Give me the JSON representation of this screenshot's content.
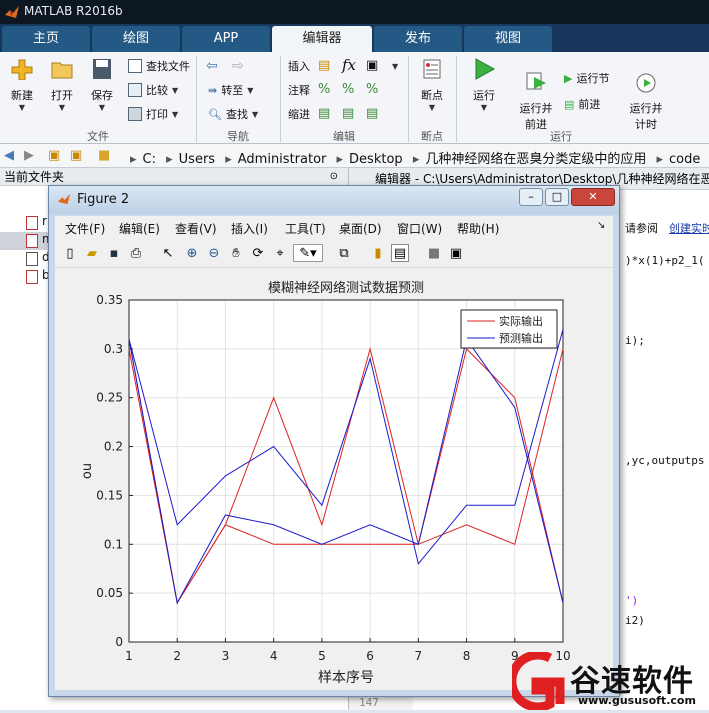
{
  "app": {
    "title": "MATLAB R2016b"
  },
  "tabs": [
    {
      "label": "主页",
      "active": false
    },
    {
      "label": "绘图",
      "active": false
    },
    {
      "label": "APP",
      "active": false
    },
    {
      "label": "编辑器",
      "active": true
    },
    {
      "label": "发布",
      "active": false
    },
    {
      "label": "视图",
      "active": false
    }
  ],
  "ribbon": {
    "new": "新建",
    "open": "打开",
    "save": "保存",
    "find_files": "查找文件",
    "compare": "比较",
    "print": "打印",
    "goto": "转至",
    "find": "查找",
    "insert": "插入",
    "comment": "注释",
    "indent": "缩进",
    "breakpoints": "断点",
    "run": "运行",
    "run_advance": "运行并\n前进",
    "run_section": "运行节",
    "advance": "前进",
    "run_time": "运行并\n计时",
    "sections": {
      "file": "文件",
      "navigate": "导航",
      "edit": "编辑",
      "breakpoints": "断点",
      "run": "运行"
    }
  },
  "address": {
    "crumbs": [
      "C:",
      "Users",
      "Administrator",
      "Desktop",
      "几种神经网络在恶臭分类定级中的应用",
      "code"
    ]
  },
  "left_panel": {
    "title": "当前文件夹",
    "items": [
      "r",
      "m",
      "d",
      "b"
    ]
  },
  "editor": {
    "title": "编辑器 - C:\\Users\\Administrator\\Desktop\\几种神经网络在恶",
    "help_text": "请参阅",
    "help_link": "创建实时",
    "code_lines": [
      ")*x(1)+p2_1(",
      "i);",
      ",yc,outputps",
      "')",
      "i2)"
    ],
    "line_number": "147"
  },
  "figure": {
    "title": "Figure 2",
    "menu": [
      "文件(F)",
      "编辑(E)",
      "查看(V)",
      "插入(I)",
      "工具(T)",
      "桌面(D)",
      "窗口(W)",
      "帮助(H)"
    ]
  },
  "chart_data": {
    "type": "line",
    "title": "模糊神经网络测试数据预测",
    "xlabel": "样本序号",
    "ylabel": "ou",
    "xlim": [
      1,
      10
    ],
    "ylim": [
      0,
      0.35
    ],
    "x": [
      1,
      2,
      3,
      4,
      5,
      6,
      7,
      8,
      9,
      10
    ],
    "xticks": [
      "1",
      "2",
      "3",
      "4",
      "5",
      "6",
      "7",
      "8",
      "9",
      "10"
    ],
    "yticks": [
      "0",
      "0.05",
      "0.1",
      "0.15",
      "0.2",
      "0.25",
      "0.3",
      "0.35"
    ],
    "grid": true,
    "legend": "top-right",
    "series": [
      {
        "name": "实际输出",
        "color": "#dd2222",
        "groups": [
          [
            0.3,
            0.04,
            0.12,
            0.25,
            0.12,
            0.3,
            0.1,
            0.3,
            0.25,
            0.04
          ],
          [
            0.31,
            0.04,
            0.12,
            0.1,
            0.1,
            0.1,
            0.1,
            0.12,
            0.1,
            0.3
          ]
        ]
      },
      {
        "name": "预测输出",
        "color": "#1a1acc",
        "groups": [
          [
            0.31,
            0.04,
            0.13,
            0.12,
            0.1,
            0.12,
            0.1,
            0.31,
            0.24,
            0.04
          ],
          [
            0.31,
            0.12,
            0.17,
            0.2,
            0.14,
            0.29,
            0.08,
            0.14,
            0.14,
            0.32
          ]
        ]
      }
    ]
  },
  "watermark": {
    "brand": "谷速软件",
    "url": "www.gususoft.com"
  }
}
